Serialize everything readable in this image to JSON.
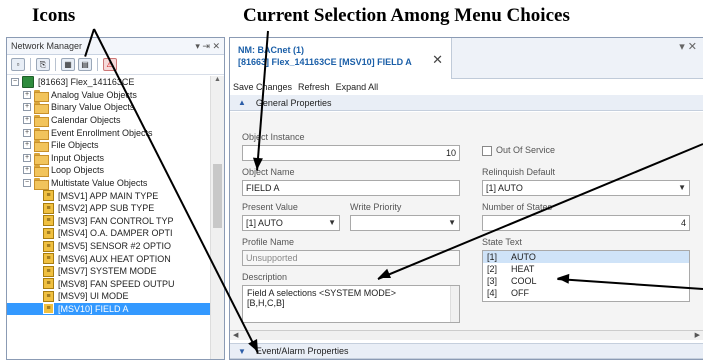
{
  "annotations": {
    "icons_label": "Icons",
    "selection_label": "Current Selection Among Menu Choices"
  },
  "network_manager": {
    "title": "Network Manager",
    "pin_glyph": "▾ ⇥ ✕",
    "toolbar_icons": [
      "collapse-icon",
      "connect-icon",
      "device-icon",
      "folder-icon",
      "alert-icon"
    ],
    "tree": [
      {
        "label": "[81663] Flex_141163CE",
        "level": 0,
        "expander": "⊟",
        "icon": "device"
      },
      {
        "label": "Analog Value Objects",
        "level": 1,
        "expander": "⊞",
        "icon": "folder"
      },
      {
        "label": "Binary Value Objects",
        "level": 1,
        "expander": "⊞",
        "icon": "folder"
      },
      {
        "label": "Calendar Objects",
        "level": 1,
        "expander": "⊞",
        "icon": "folder"
      },
      {
        "label": "Event Enrollment Objects",
        "level": 1,
        "expander": "⊞",
        "icon": "folder"
      },
      {
        "label": "File Objects",
        "level": 1,
        "expander": "⊞",
        "icon": "folder"
      },
      {
        "label": "Input Objects",
        "level": 1,
        "expander": "⊞",
        "icon": "folder"
      },
      {
        "label": "Loop Objects",
        "level": 1,
        "expander": "⊞",
        "icon": "folder"
      },
      {
        "label": "Multistate Value Objects",
        "level": 1,
        "expander": "⊟",
        "icon": "folder"
      },
      {
        "label": "[MSV1] APP MAIN TYPE",
        "level": 2,
        "icon": "object"
      },
      {
        "label": "[MSV2] APP SUB TYPE",
        "level": 2,
        "icon": "object"
      },
      {
        "label": "[MSV3] FAN CONTROL TYP",
        "level": 2,
        "icon": "object"
      },
      {
        "label": "[MSV4] O.A. DAMPER OPTI",
        "level": 2,
        "icon": "object"
      },
      {
        "label": "[MSV5] SENSOR #2 OPTIO",
        "level": 2,
        "icon": "object"
      },
      {
        "label": "[MSV6] AUX HEAT OPTION",
        "level": 2,
        "icon": "object"
      },
      {
        "label": "[MSV7] SYSTEM MODE",
        "level": 2,
        "icon": "object"
      },
      {
        "label": "[MSV8] FAN SPEED OUTPU",
        "level": 2,
        "icon": "object"
      },
      {
        "label": "[MSV9] UI MODE",
        "level": 2,
        "icon": "object"
      },
      {
        "label": "[MSV10] FIELD A",
        "level": 2,
        "icon": "object",
        "selected": true
      }
    ]
  },
  "detail": {
    "tab_line1": "NM: BACnet (1)",
    "tab_line2": "[81663] Flex_141163CE [MSV10] FIELD A",
    "toolbar": {
      "save": "Save Changes",
      "refresh": "Refresh",
      "expand": "Expand All"
    },
    "general_header": "General Properties",
    "event_header": "Event/Alarm Properties",
    "object_instance": {
      "label": "Object Instance",
      "value": "10"
    },
    "out_of_service": {
      "label": "Out Of Service",
      "checked": false
    },
    "object_name": {
      "label": "Object Name",
      "value": "FIELD A"
    },
    "relinquish_default": {
      "label": "Relinquish Default",
      "value": "[1] AUTO"
    },
    "present_value": {
      "label": "Present Value",
      "value": "[1] AUTO"
    },
    "write_priority": {
      "label": "Write Priority",
      "value": ""
    },
    "number_of_states": {
      "label": "Number of States",
      "value": "4"
    },
    "profile_name": {
      "label": "Profile Name",
      "value": "Unsupported"
    },
    "state_text": {
      "label": "State Text",
      "items": [
        {
          "num": "[1]",
          "text": "AUTO",
          "selected": true
        },
        {
          "num": "[2]",
          "text": "HEAT",
          "selected": false
        },
        {
          "num": "[3]",
          "text": "COOL",
          "selected": false
        },
        {
          "num": "[4]",
          "text": "OFF",
          "selected": false
        }
      ]
    },
    "description": {
      "label": "Description",
      "line1": "Field A selections <SYSTEM MODE>",
      "line2": "[B,H,C,B]"
    }
  }
}
